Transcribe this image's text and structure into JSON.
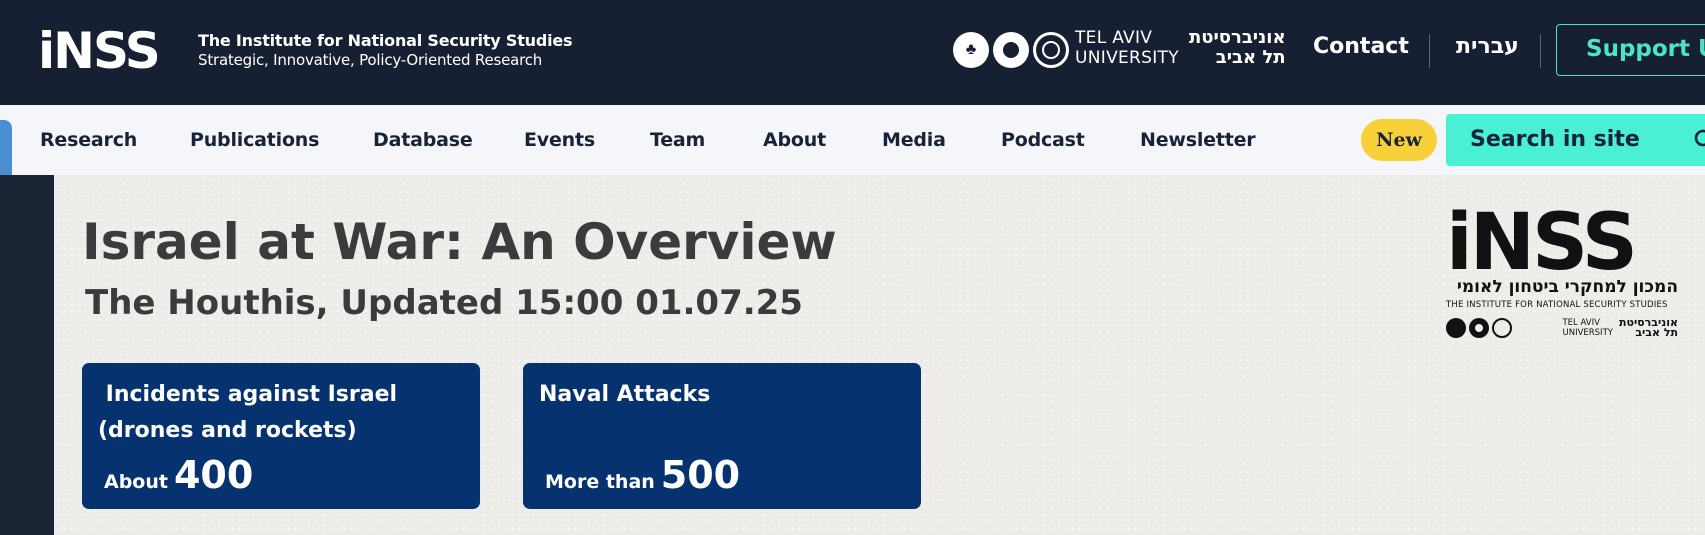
{
  "header": {
    "logo_text": "iNSS",
    "logo_title": "The Institute for National Security Studies",
    "logo_tagline": "Strategic, Innovative, Policy-Oriented Research",
    "tau_en_line1": "TEL AVIV",
    "tau_en_line2": "UNIVERSITY",
    "tau_he_line1": "אוניברסיטת",
    "tau_he_line2": "תל אביב",
    "contact": "Contact",
    "hebrew": "עברית",
    "support": "Support Us"
  },
  "nav": {
    "items": [
      "Research",
      "Publications",
      "Database",
      "Events",
      "Team",
      "About",
      "Media",
      "Podcast",
      "Newsletter"
    ],
    "new_badge": "New",
    "search_label": "Search in site"
  },
  "main": {
    "title": "Israel at War: An Overview",
    "subtitle": "The Houthis, Updated 15:00 01.07.25",
    "cards": [
      {
        "title": " Incidents against Israel\n(drones and rockets)",
        "prefix": "About",
        "value": "400"
      },
      {
        "title": "Naval Attacks",
        "prefix": "More than",
        "value": "500"
      }
    ],
    "side_logo": {
      "mark": "iNSS",
      "hebrew_name": "המכון למחקרי ביטחון לאומי",
      "english_name": "THE INSTITUTE FOR NATIONAL SECURITY STUDIES",
      "tau_en_line1": "TEL AVIV",
      "tau_en_line2": "UNIVERSITY",
      "tau_he_line1": "אוניברסיטת",
      "tau_he_line2": "תל אביב"
    }
  },
  "colors": {
    "header_bg": "#172032",
    "accent_teal": "#49f0d3",
    "card_bg": "#06336f",
    "badge_yellow": "#f7d03a",
    "nav_bg": "#f4f6fa"
  },
  "icons": {
    "search": "search-icon",
    "tau_emblem": "tree-emblem-icon"
  }
}
